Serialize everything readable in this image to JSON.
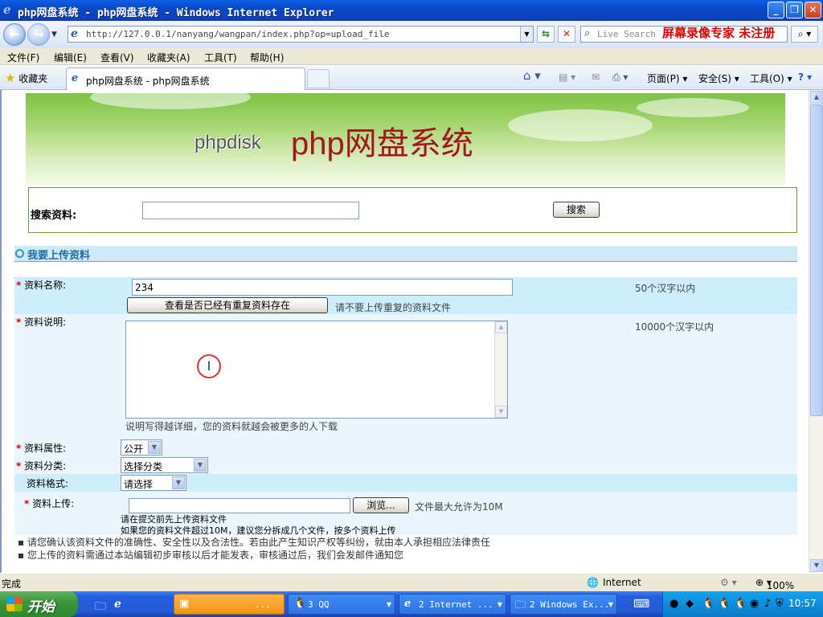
{
  "window": {
    "title": "php网盘系统 - php网盘系统 - Windows Internet Explorer",
    "min": "_",
    "max": "❐",
    "close": "✕"
  },
  "address": {
    "url": "http://127.0.0.1/nanyang/wangpan/index.php?op=upload_file",
    "search_placeholder": "Live Search",
    "watermark": "屏幕录像专家 未注册"
  },
  "menu": [
    "文件(F)",
    "编辑(E)",
    "查看(V)",
    "收藏夹(A)",
    "工具(T)",
    "帮助(H)"
  ],
  "cmdbar": {
    "favorites": "收藏夹",
    "tab_title": "php网盘系统 - php网盘系统",
    "page": "页面(P)",
    "safety": "安全(S)",
    "tools": "工具(O)"
  },
  "banner": {
    "brand_small": "phpdisk",
    "brand_big": "php网盘系统"
  },
  "search": {
    "label": "搜索资料:",
    "value": "",
    "button": "搜索"
  },
  "section": {
    "title": "我要上传资料"
  },
  "form": {
    "name_label": "资料名称:",
    "name_value": "234",
    "name_hint": "50个汉字以内",
    "dup_button": "查看是否已经有重复资料存在",
    "dup_hint": "请不要上传重复的资料文件",
    "desc_label": "资料说明:",
    "desc_hint": "10000个汉字以内",
    "desc_note": "说明写得越详细，您的资料就越会被更多的人下载",
    "attr_label": "资料属性:",
    "attr_value": "公开",
    "category_label": "资料分类:",
    "category_value": "选择分类",
    "format_label": "资料格式:",
    "format_value": "请选择",
    "upload_label": "资料上传:",
    "upload_value": "",
    "browse_button": "浏览...",
    "upload_limit": "文件最大允许为10M",
    "upload_note1": "请在提交前先上传资料文件",
    "upload_note2": "如果您的资料文件超过10M，建议您分拆成几个文件，按多个资料上传",
    "notice1": "请您确认该资料文件的准确性、安全性以及合法性。若由此产生知识产权等纠纷，就由本人承担相应法律责任",
    "notice2": "您上传的资料需通过本站编辑初步审核以后才能发表，审核通过后，我们会发邮件通知您"
  },
  "status": {
    "text": "完成",
    "zone": "Internet",
    "zoom": "100%"
  },
  "taskbar": {
    "start": "开始",
    "tasks": [
      {
        "label": "...",
        "active": true
      },
      {
        "label": "3 QQ",
        "active": false
      },
      {
        "label": "2 Internet ...",
        "active": false
      },
      {
        "label": "2 Windows Ex...",
        "active": false
      }
    ],
    "clock": "10:57"
  }
}
